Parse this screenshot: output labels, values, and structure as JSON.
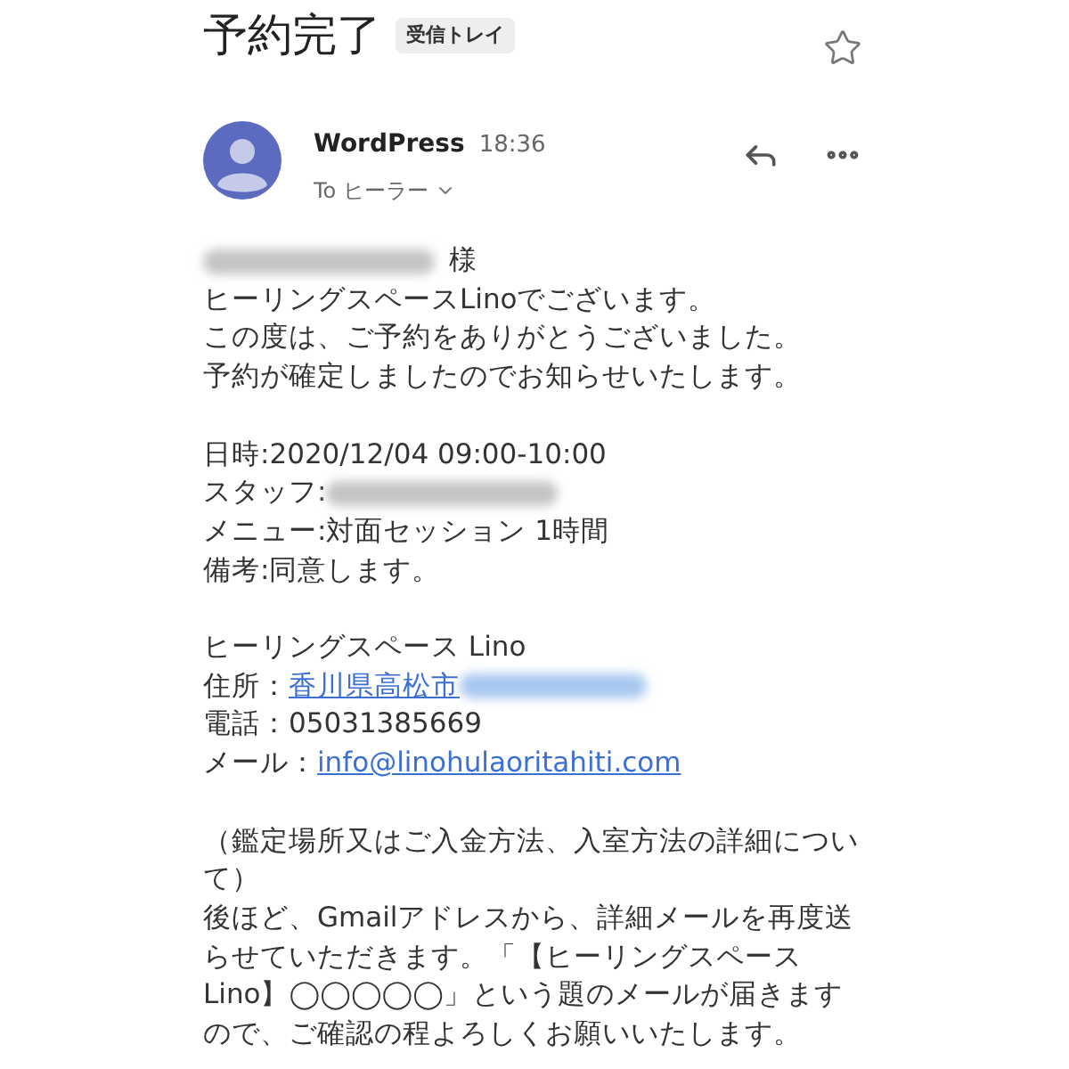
{
  "header": {
    "title": "予約完了",
    "label": "受信トレイ",
    "starred": false
  },
  "message": {
    "sender": "WordPress",
    "time": "18:36",
    "recipient": "To ヒーラー"
  },
  "body": [
    {
      "kind": "line",
      "segments": [
        {
          "kind": "redacted"
        },
        {
          "kind": "text",
          "text": "様"
        }
      ]
    },
    {
      "kind": "line",
      "segments": [
        {
          "kind": "text",
          "text": "ヒーリングスペースLinoでございます。"
        }
      ]
    },
    {
      "kind": "line",
      "segments": [
        {
          "kind": "text",
          "text": "この度は、ご予約をありがとうございました。"
        }
      ]
    },
    {
      "kind": "line",
      "segments": [
        {
          "kind": "text",
          "text": "予約が確定しましたのでお知らせいたします。"
        }
      ]
    },
    {
      "kind": "blank"
    },
    {
      "kind": "line",
      "segments": [
        {
          "kind": "text",
          "text": "日時:2020/12/04 09:00-10:00"
        }
      ]
    },
    {
      "kind": "line",
      "segments": [
        {
          "kind": "text",
          "text": "スタッフ:"
        },
        {
          "kind": "redacted"
        }
      ]
    },
    {
      "kind": "line",
      "segments": [
        {
          "kind": "text",
          "text": "メニュー:対面セッション 1時間"
        }
      ]
    },
    {
      "kind": "line",
      "segments": [
        {
          "kind": "text",
          "text": "備考:同意します。"
        }
      ]
    },
    {
      "kind": "blank"
    },
    {
      "kind": "line",
      "segments": [
        {
          "kind": "text",
          "text": "ヒーリングスペース Lino"
        }
      ]
    },
    {
      "kind": "line",
      "segments": [
        {
          "kind": "text",
          "text": "住所："
        },
        {
          "kind": "link",
          "text": "香川県高松市"
        },
        {
          "kind": "redacted_link"
        }
      ]
    },
    {
      "kind": "line",
      "segments": [
        {
          "kind": "text",
          "text": "電話：05031385669"
        }
      ]
    },
    {
      "kind": "line",
      "segments": [
        {
          "kind": "text",
          "text": "メール："
        },
        {
          "kind": "link",
          "text": "info@linohulaoritahiti.com"
        }
      ]
    },
    {
      "kind": "blank"
    },
    {
      "kind": "line",
      "segments": [
        {
          "kind": "text",
          "text": "（鑑定場所又はご入金方法、入室方法の詳細について）"
        }
      ]
    },
    {
      "kind": "line",
      "segments": [
        {
          "kind": "text",
          "text": "後ほど、Gmailアドレスから、詳細メールを再度送らせていただきます。「【ヒーリングスペースLino】◯◯◯◯◯」という題のメールが届きますので、ご確認の程よろしくお願いいたします。"
        }
      ]
    }
  ]
}
